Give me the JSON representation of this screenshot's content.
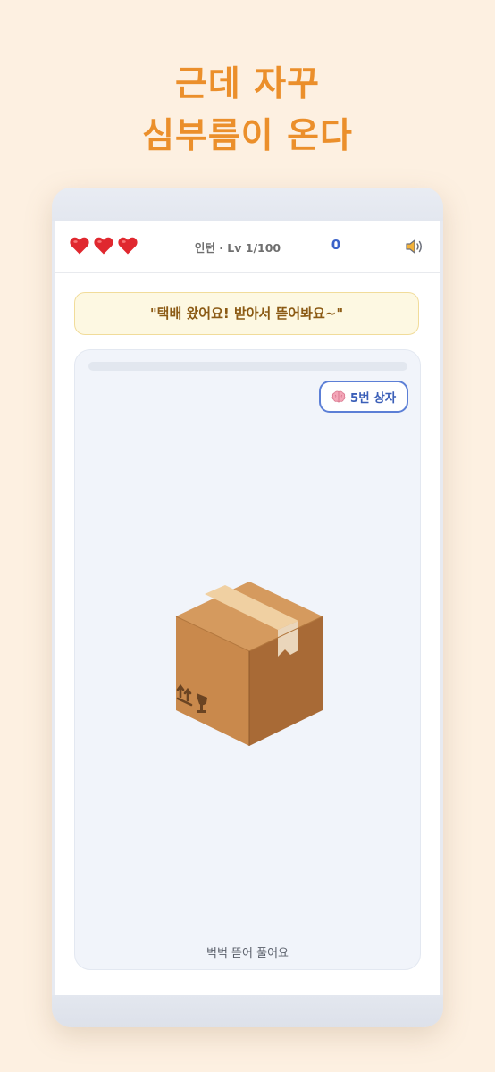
{
  "headline": {
    "line1": "근데 자꾸",
    "line2": "심부름이 온다"
  },
  "status": {
    "lives": 3,
    "level_text": "인턴 · Lv 1/100",
    "score": "0",
    "sound_icon": "speaker-icon"
  },
  "speech": "\"택배 왔어요! 받아서 뜯어봐요~\"",
  "game": {
    "progress": 0,
    "box_chip": {
      "icon": "brain-icon",
      "label": "5번 상자"
    },
    "package_icon": "package-icon",
    "hint": "벅벅 뜯어 풀어요"
  },
  "colors": {
    "background": "#fdf0e1",
    "headline": "#eb8f2b",
    "accent_blue": "#3b63c9",
    "heart": "#e0282f"
  }
}
